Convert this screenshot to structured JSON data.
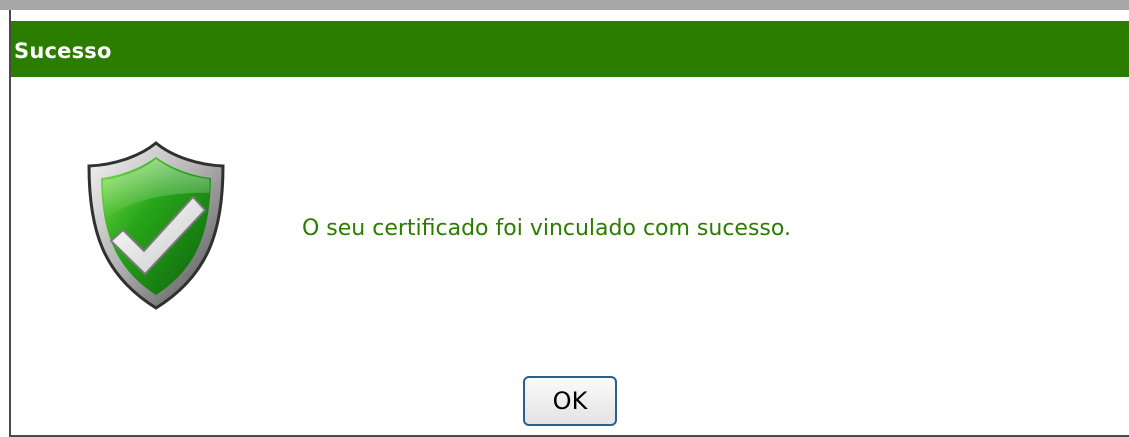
{
  "dialog": {
    "title": "Sucesso",
    "message": "O seu certificado foi vinculado com sucesso.",
    "ok_label": "OK",
    "icon": "success-shield-icon"
  },
  "colors": {
    "title_bar": "#2b7d00",
    "message_text": "#2b7d00",
    "border": "#4a4a4a"
  }
}
